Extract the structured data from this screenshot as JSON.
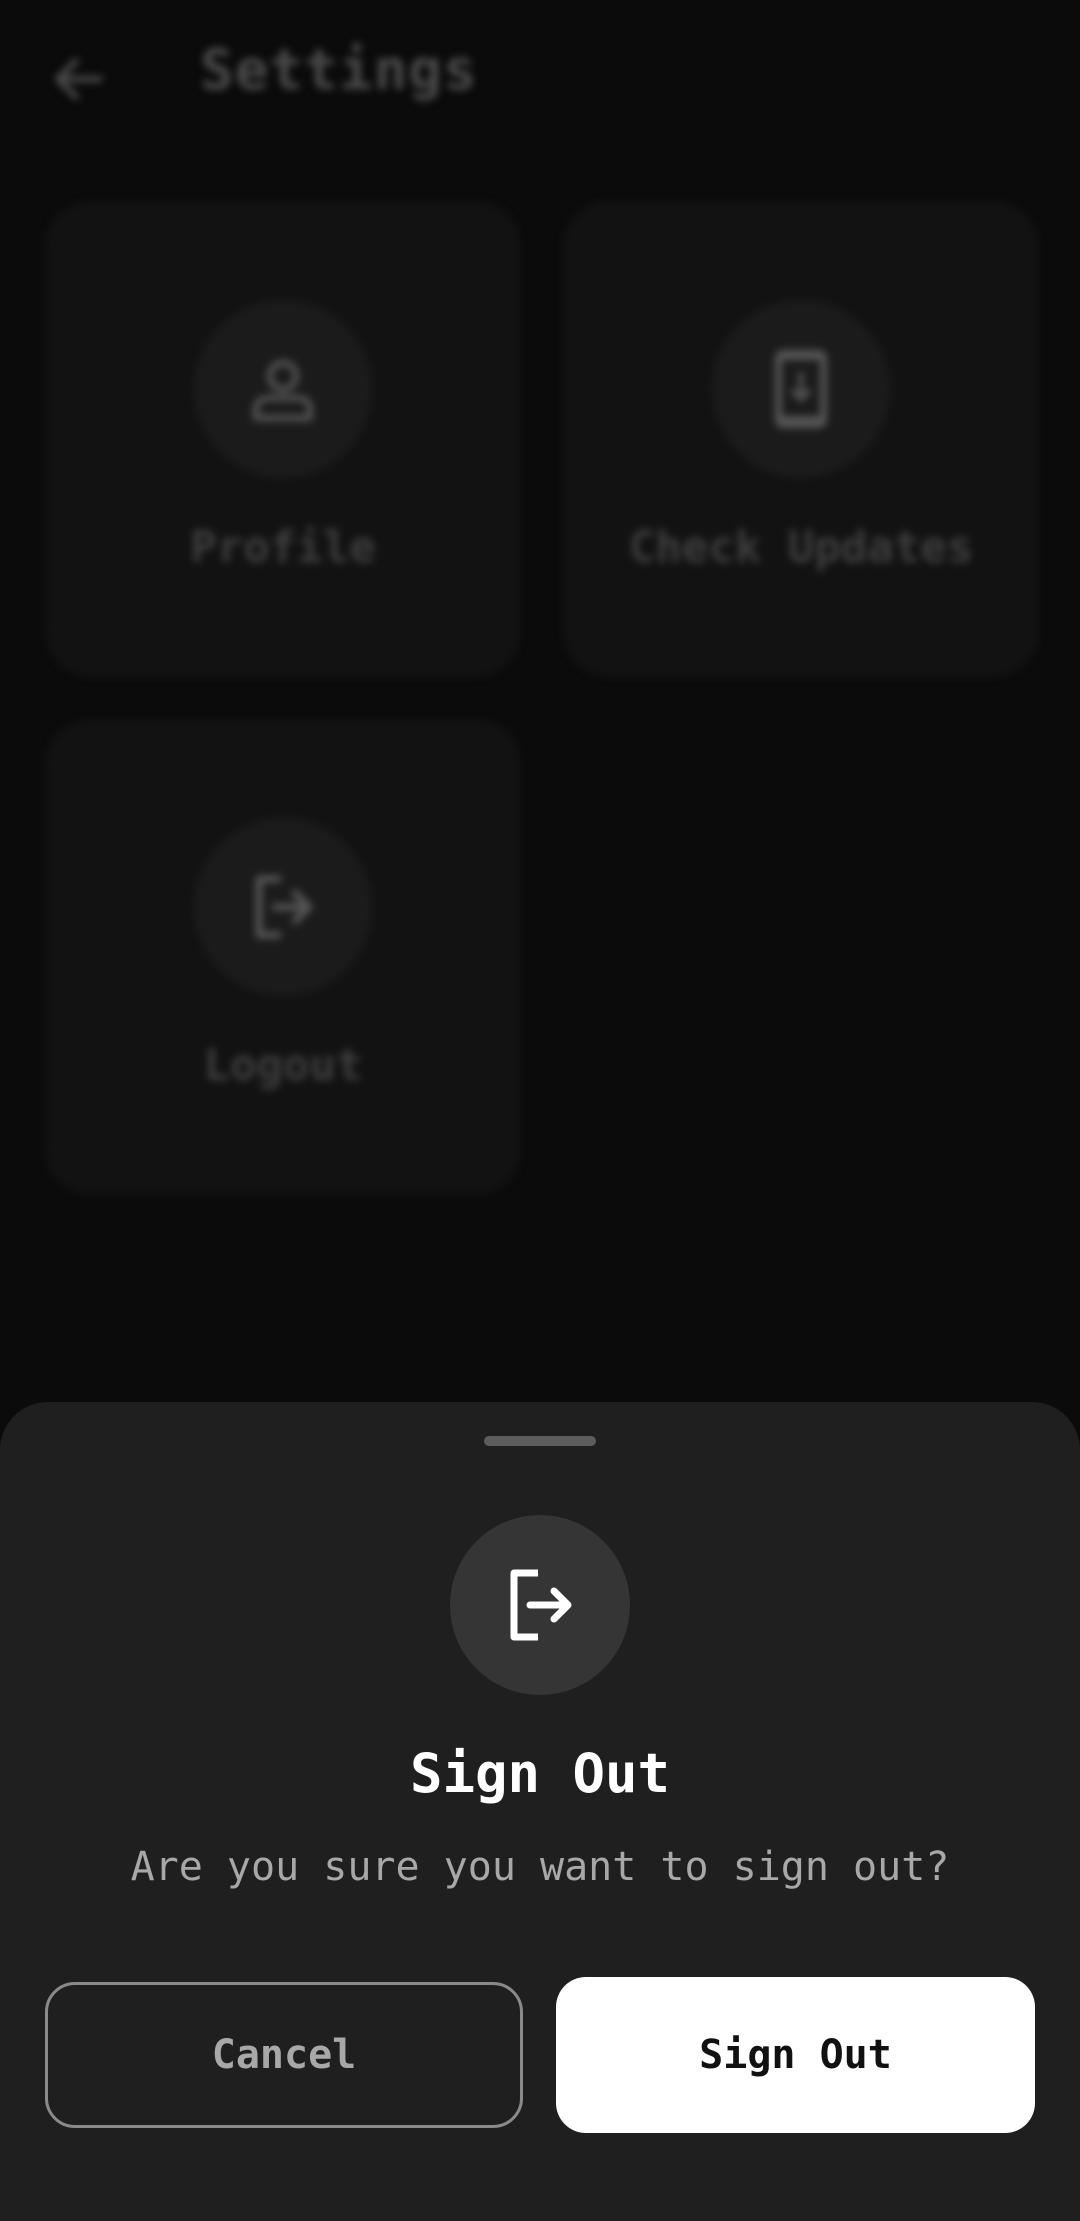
{
  "header": {
    "title": "Settings",
    "back_icon": "arrow-left-icon"
  },
  "cards": [
    {
      "label": "Profile",
      "icon": "person-icon"
    },
    {
      "label": "Check Updates",
      "icon": "phone-download-icon"
    },
    {
      "label": "Logout",
      "icon": "logout-icon"
    }
  ],
  "sheet": {
    "icon": "logout-icon",
    "title": "Sign Out",
    "message": "Are you sure you want to sign out?",
    "cancel_label": "Cancel",
    "confirm_label": "Sign Out"
  },
  "colors": {
    "background": "#0b0b0b",
    "sheet": "#1f1f1f",
    "confirm_button": "#ffffff",
    "muted_text": "#a8a8a8"
  }
}
